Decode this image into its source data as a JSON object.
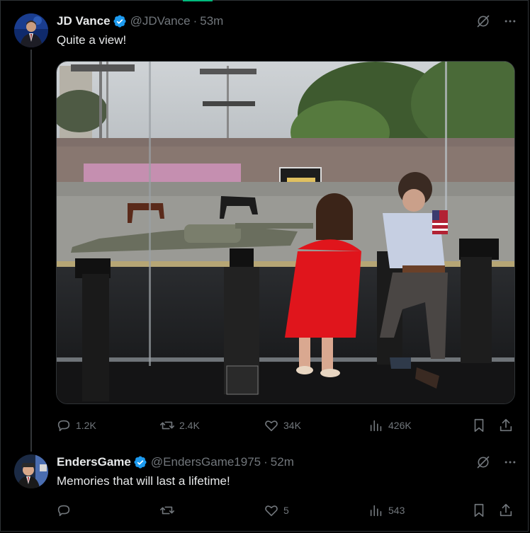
{
  "colors": {
    "background": "#000000",
    "text_primary": "#e7e9ea",
    "text_secondary": "#71767b",
    "verified_badge": "#1d9bf0",
    "divider": "#2f3336",
    "accent": "#00ba7c"
  },
  "tweets": [
    {
      "display_name": "JD Vance",
      "handle": "@JDVance",
      "separator": "·",
      "time": "53m",
      "text": "Quite a view!",
      "media": true,
      "stats": {
        "replies": "1.2K",
        "reposts": "2.4K",
        "likes": "34K",
        "views": "426K"
      }
    },
    {
      "display_name": "EndersGame",
      "handle": "@EndersGame1975",
      "separator": "·",
      "time": "52m",
      "text": "Memories that will last a lifetime!",
      "media": false,
      "stats": {
        "replies": "",
        "reposts": "",
        "likes": "5",
        "views": "543"
      }
    }
  ],
  "icons": {
    "verified": "verified-badge-icon",
    "grok": "grok-icon",
    "more": "more-icon",
    "reply": "reply-icon",
    "repost": "repost-icon",
    "like": "like-icon",
    "views": "views-icon",
    "bookmark": "bookmark-icon",
    "share": "share-icon"
  }
}
